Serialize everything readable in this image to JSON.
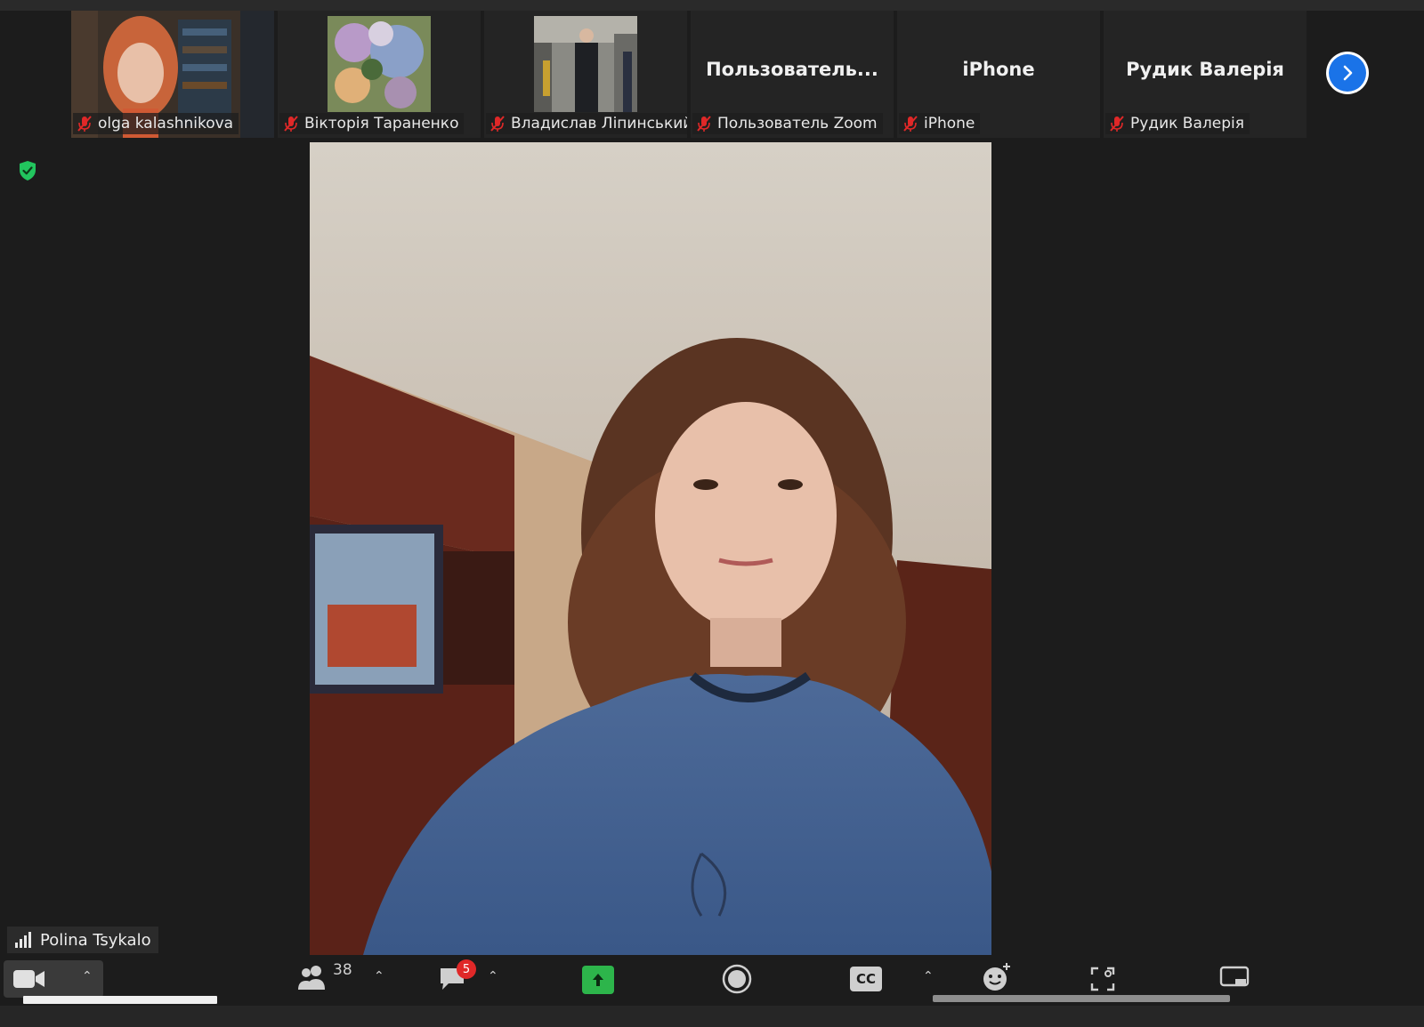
{
  "participants": [
    {
      "name": "olga kalashnikova",
      "display": "",
      "has_video": true
    },
    {
      "name": "Вікторія Тараненко",
      "display": "",
      "has_video": true
    },
    {
      "name": "Владислав Ліпинський",
      "display": "",
      "has_video": true
    },
    {
      "name": "Пользователь Zoom",
      "display": "Пользователь...",
      "has_video": false
    },
    {
      "name": "iPhone",
      "display": "iPhone",
      "has_video": false
    },
    {
      "name": "Рудик Валерія",
      "display": "Рудик Валерія",
      "has_video": false
    }
  ],
  "active_speaker": {
    "name": "Polina Tsykalo"
  },
  "toolbar": {
    "participant_count": "38",
    "chat_badge": "5",
    "cc_label": "CC"
  },
  "colors": {
    "background": "#1c1c1c",
    "accent_blue": "#1a73e8",
    "share_green": "#2db54b",
    "mute_red": "#e02828",
    "shield_green": "#22c55e"
  },
  "icons": [
    "mute-mic-icon",
    "next-page-icon",
    "shield-icon",
    "signal-icon",
    "video-camera-icon",
    "participants-icon",
    "chat-icon",
    "share-screen-icon",
    "record-icon",
    "cc-icon",
    "reactions-icon",
    "apps-icon",
    "whiteboard-icon"
  ]
}
